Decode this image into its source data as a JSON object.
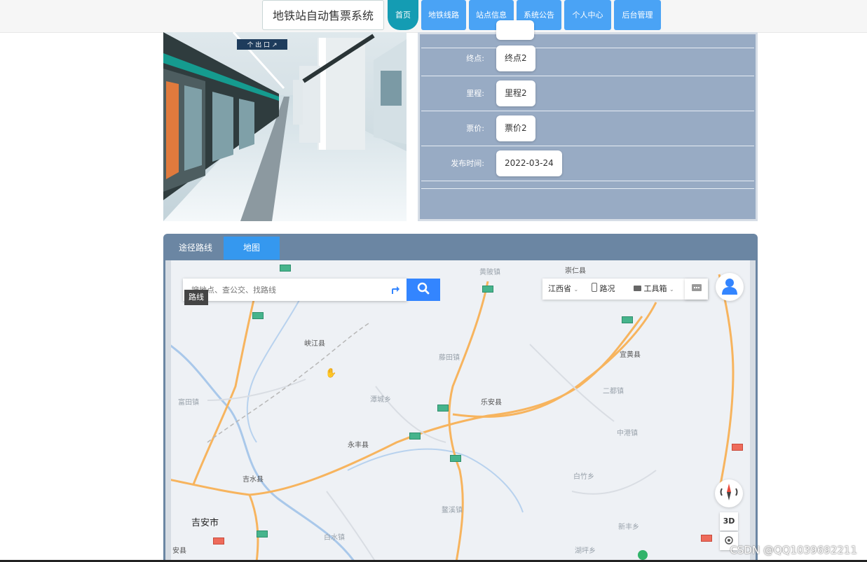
{
  "header": {
    "site_title": "地铁站自动售票系统",
    "nav": [
      {
        "label": "首页",
        "active": true
      },
      {
        "label": "地铁线路"
      },
      {
        "label": "站点信息"
      },
      {
        "label": "系统公告"
      },
      {
        "label": "个人中心"
      },
      {
        "label": "后台管理"
      }
    ]
  },
  "photo": {
    "sign_text": "个 出 口 ↗"
  },
  "detail": {
    "rows": [
      {
        "label": "终点:",
        "value": "终点2"
      },
      {
        "label": "里程:",
        "value": "里程2"
      },
      {
        "label": "票价:",
        "value": "票价2"
      },
      {
        "label": "发布时间:",
        "value": "2022-03-24"
      }
    ]
  },
  "map_section": {
    "tabs": [
      {
        "label": "途径路线"
      },
      {
        "label": "地图",
        "active": true
      }
    ],
    "search": {
      "placeholder": "搜地点、查公交、找路线",
      "tooltip": "路线"
    },
    "toolbar": {
      "province": "江西省",
      "traffic": "路况",
      "toolbox": "工具箱"
    },
    "btn_3d": "3D",
    "places": [
      {
        "name": "吉安市",
        "kind": "city"
      },
      {
        "name": "峡江县"
      },
      {
        "name": "乐安县"
      },
      {
        "name": "永丰县"
      },
      {
        "name": "吉水县"
      },
      {
        "name": "宜黄县"
      },
      {
        "name": "崇仁县"
      },
      {
        "name": "藤田镇"
      },
      {
        "name": "二都镇"
      },
      {
        "name": "中港镇"
      },
      {
        "name": "白竹乡"
      },
      {
        "name": "新丰乡"
      },
      {
        "name": "湖坪乡"
      },
      {
        "name": "黄陂镇"
      },
      {
        "name": "安县"
      },
      {
        "name": "富田镇"
      },
      {
        "name": "潭城乡"
      },
      {
        "name": "白水镇"
      },
      {
        "name": "鳌溪镇"
      }
    ]
  },
  "watermark": "CSDN @QQ1039692211",
  "colors": {
    "nav_blue": "#4aa3f5",
    "nav_active": "#149cb3",
    "panel": "#98abc4",
    "tab_bar": "#6b86a3",
    "tab_active": "#3598ef",
    "map_search_button": "#3385ff"
  }
}
